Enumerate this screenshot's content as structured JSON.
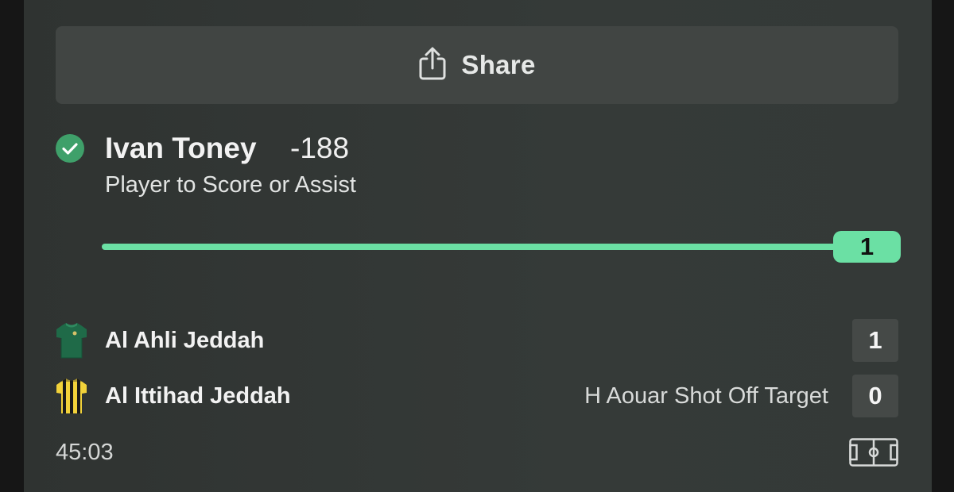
{
  "share": {
    "label": "Share",
    "icon": "share-icon"
  },
  "selection": {
    "status_icon": "check-circle-icon",
    "status_color": "#3fa06a",
    "player": "Ivan Toney",
    "odds": "-188",
    "market": "Player to Score or Assist",
    "progress": {
      "value": "1",
      "fraction": 1.0,
      "color": "#6be0a4"
    }
  },
  "match": {
    "teams": [
      {
        "name": "Al Ahli Jeddah",
        "kit_icon": "green-jersey-icon",
        "score": "1",
        "event": ""
      },
      {
        "name": "Al Ittihad Jeddah",
        "kit_icon": "yellow-black-striped-jersey-icon",
        "score": "0",
        "event": "H Aouar Shot Off Target"
      }
    ],
    "clock": "45:03",
    "pitch_icon": "pitch-icon"
  }
}
